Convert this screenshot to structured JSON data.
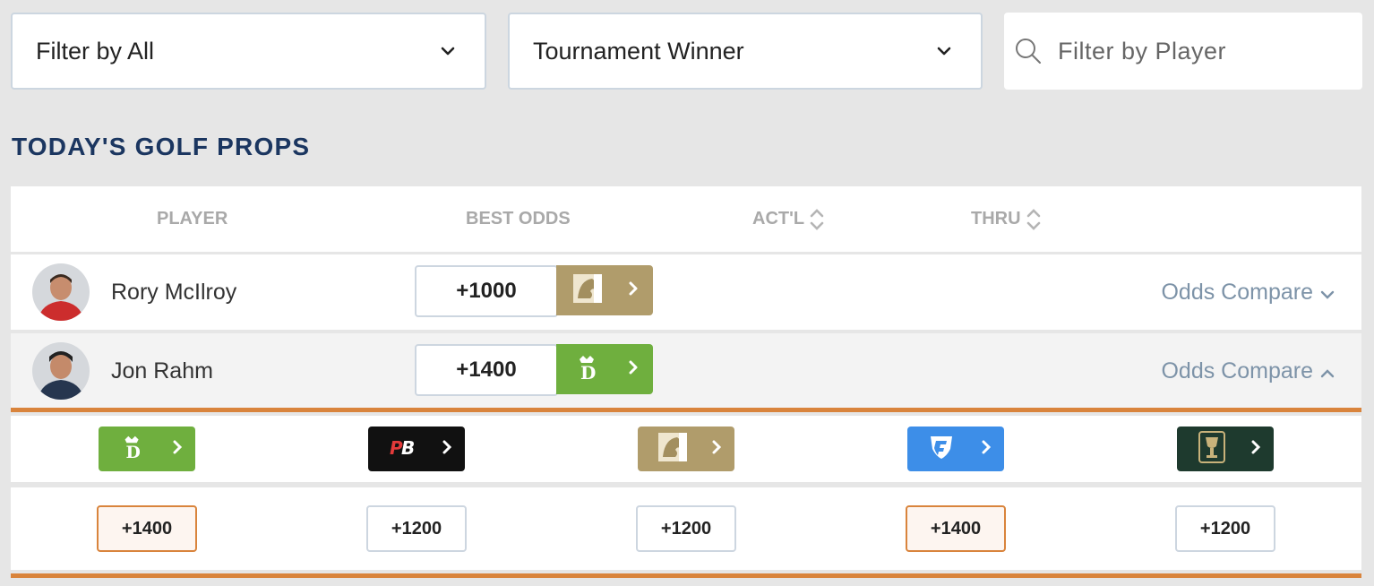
{
  "filters": {
    "type": "Filter by All",
    "market": "Tournament Winner",
    "player_placeholder": "Filter by Player"
  },
  "section_title": "TODAY'S GOLF PROPS",
  "columns": {
    "player": "PLAYER",
    "best_odds": "BEST ODDS",
    "actual": "ACT'L",
    "thru": "THRU"
  },
  "rows": [
    {
      "player": "Rory McIlroy",
      "best_odds": "+1000",
      "book": "betmgm-logo",
      "odds_compare": "Odds Compare"
    },
    {
      "player": "Jon Rahm",
      "best_odds": "+1400",
      "book": "draftkings-logo",
      "odds_compare": "Odds Compare"
    }
  ],
  "compare": {
    "books": [
      "draftkings-logo",
      "pointsbet-logo",
      "betmgm-logo",
      "fanduel-logo",
      "caesars-logo"
    ],
    "odds": [
      "+1400",
      "+1200",
      "+1200",
      "+1400",
      "+1200"
    ]
  },
  "colors": {
    "accent_orange": "#d9843c",
    "title_navy": "#1b3660",
    "draftkings_green": "#6faf3e",
    "betmgm_gold": "#b09c6b",
    "fanduel_blue": "#3d8ee8",
    "pointsbet_black": "#111111",
    "caesars_green": "#1e3a2e"
  }
}
